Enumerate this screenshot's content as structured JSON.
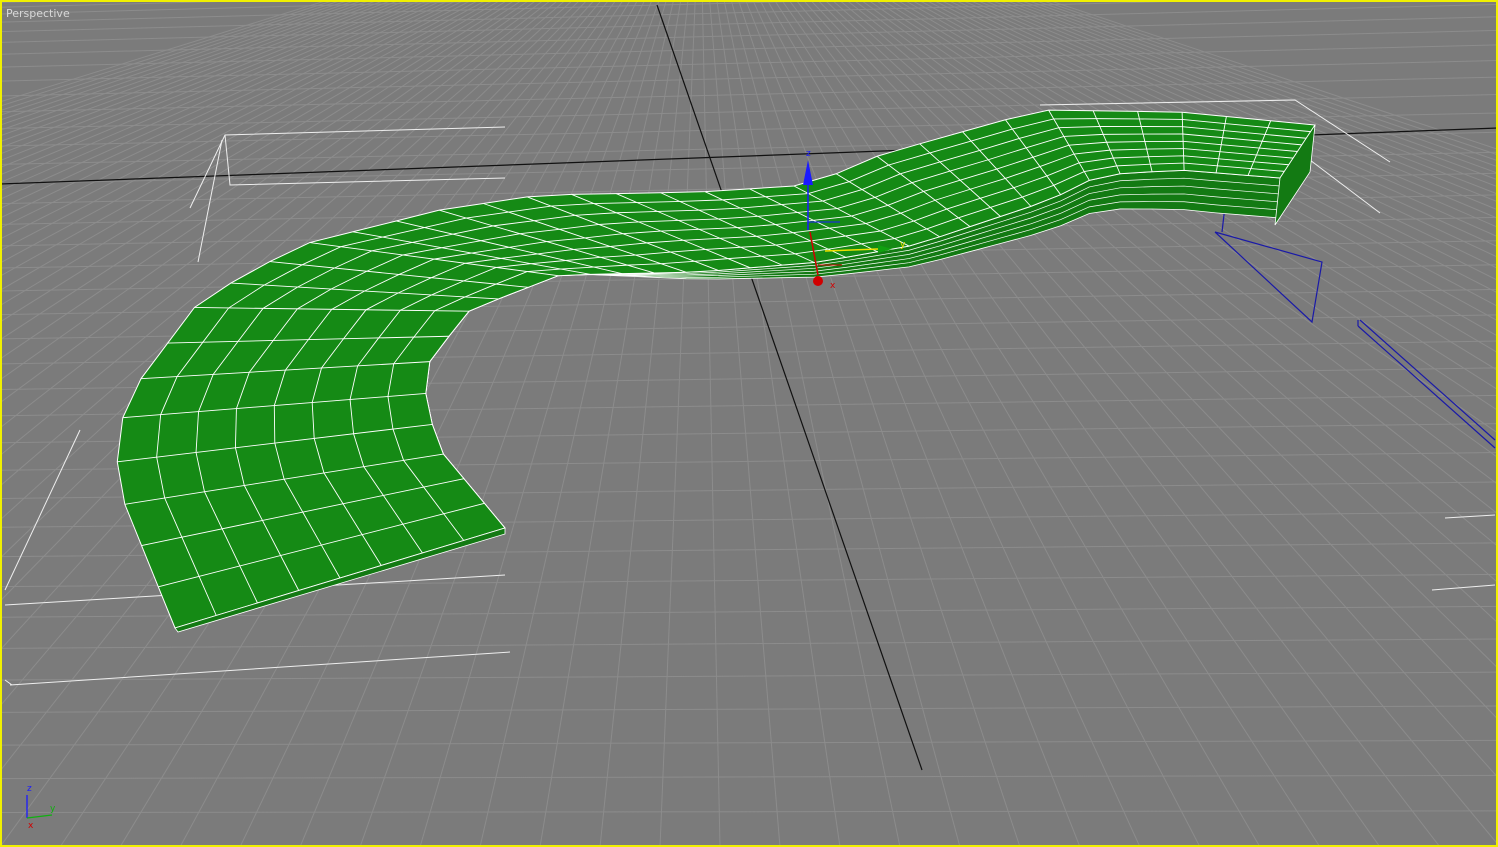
{
  "viewport": {
    "label": "Perspective",
    "active_border_color": "#f0f000",
    "background_color": "#7b7b7b",
    "object_color": "#158a15",
    "wire_color": "#ffffff"
  },
  "gizmo": {
    "x_label": "x",
    "y_label": "y",
    "z_label": "z"
  },
  "view_axis": {
    "x_label": "x",
    "y_label": "y",
    "z_label": "z"
  }
}
